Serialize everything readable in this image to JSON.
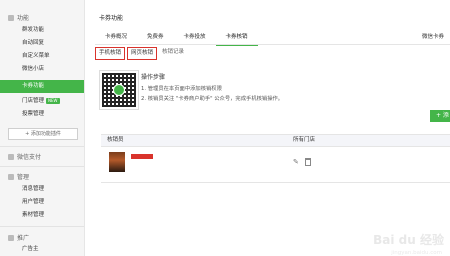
{
  "sidebar": {
    "group_features": "功能",
    "items": [
      {
        "label": "群发功能",
        "active": false
      },
      {
        "label": "自动回复",
        "active": false
      },
      {
        "label": "自定义菜单",
        "active": false
      },
      {
        "label": "微信小店",
        "active": false
      },
      {
        "label": "卡券功能",
        "active": true
      },
      {
        "label": "门店管理",
        "new": "NEW"
      },
      {
        "label": "投票管理",
        "active": false
      }
    ],
    "add_plugin": "+ 添加功能插件",
    "group_pay": "微信支付",
    "group_manage": "管理",
    "manage_items": [
      "消息管理",
      "用户管理",
      "素材管理"
    ],
    "group_promo": "推广",
    "promo_items": [
      "广告主"
    ]
  },
  "main": {
    "title": "卡券功能",
    "tabs": [
      "卡券概况",
      "免费券",
      "卡券投放",
      "卡券核销"
    ],
    "tab_right": "微信卡券",
    "subtabs": [
      "手机核销",
      "网页核销",
      "核销记录"
    ],
    "steps_title": "操作步骤",
    "steps": [
      "1. 管理员在本页面中添加核销权限",
      "2. 核销员关注 \"卡券商户助手\" 公众号，完成手机核销操作。"
    ],
    "add_button": "+ 添",
    "table": {
      "col_verifier": "核销员",
      "col_store": "所有门店"
    }
  },
  "watermark": "Bai du 经验",
  "watermark_sub": "jingyan.baidu.com",
  "colors": {
    "accent": "#44b549",
    "highlight_red": "#d9332c"
  }
}
